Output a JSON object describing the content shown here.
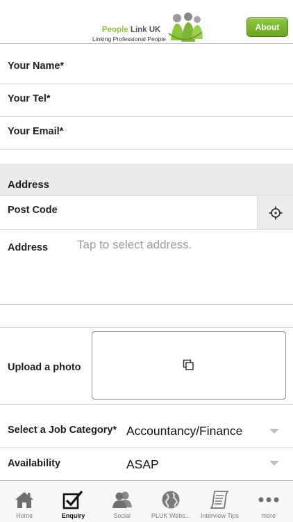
{
  "header": {
    "logo_title_part1": "People",
    "logo_title_part2": "Link UK",
    "logo_tagline": "Linking Professional People",
    "about_label": "About",
    "accent_color": "#7ab530"
  },
  "form": {
    "name_label": "Your Name*",
    "name_value": "",
    "tel_label": "Your Tel*",
    "tel_value": "",
    "email_label": "Your Email*",
    "email_value": "",
    "address_section_title": "Address",
    "postcode_label": "Post Code",
    "postcode_value": "",
    "address_label": "Address",
    "address_placeholder": "Tap to select address.",
    "upload_label": "Upload a photo",
    "job_category_label": "Select a Job Category*",
    "job_category_value": "Accountancy/Finance",
    "availability_label": "Availability",
    "availability_value": "ASAP"
  },
  "tabbar": {
    "tabs": [
      {
        "label": "Home",
        "icon": "house-icon",
        "active": false
      },
      {
        "label": "Enquiry",
        "icon": "checkbox-icon",
        "active": true
      },
      {
        "label": "Social",
        "icon": "people-icon",
        "active": false
      },
      {
        "label": "PLUK Webs...",
        "icon": "globe-icon",
        "active": false
      },
      {
        "label": "Interview Tips",
        "icon": "scroll-icon",
        "active": false
      },
      {
        "label": "more",
        "icon": "ellipsis-icon",
        "active": false
      }
    ]
  }
}
